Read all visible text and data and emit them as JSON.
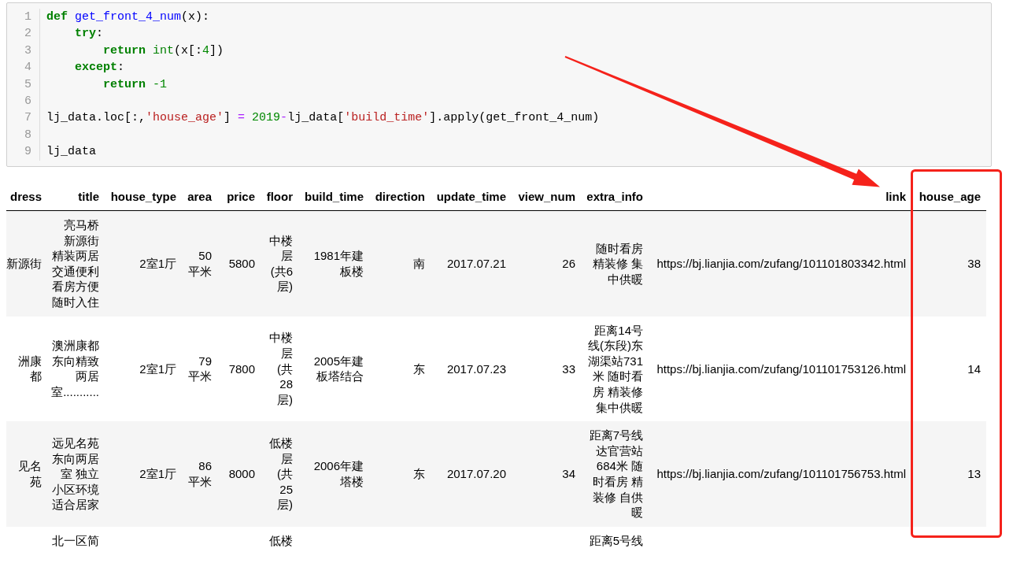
{
  "code_cell": {
    "lines": [
      {
        "number": "1",
        "tokens": [
          {
            "text": "def ",
            "kind": "keyword"
          },
          {
            "text": "get_front_4_num",
            "kind": "def"
          },
          {
            "text": "(x):",
            "kind": "plain"
          }
        ]
      },
      {
        "number": "2",
        "tokens": [
          {
            "text": "    try",
            "kind": "keyword"
          },
          {
            "text": ":",
            "kind": "plain"
          }
        ]
      },
      {
        "number": "3",
        "tokens": [
          {
            "text": "        return ",
            "kind": "keyword"
          },
          {
            "text": "int",
            "kind": "builtin"
          },
          {
            "text": "(x[:",
            "kind": "plain"
          },
          {
            "text": "4",
            "kind": "number"
          },
          {
            "text": "])",
            "kind": "plain"
          }
        ]
      },
      {
        "number": "4",
        "tokens": [
          {
            "text": "    except",
            "kind": "keyword"
          },
          {
            "text": ":",
            "kind": "plain"
          }
        ]
      },
      {
        "number": "5",
        "tokens": [
          {
            "text": "        return ",
            "kind": "keyword"
          },
          {
            "text": "-1",
            "kind": "number"
          }
        ]
      },
      {
        "number": "6"
      },
      {
        "number": "7",
        "tokens": [
          {
            "text": "lj_data.loc[:,",
            "kind": "plain"
          },
          {
            "text": "'house_age'",
            "kind": "string"
          },
          {
            "text": "] ",
            "kind": "plain"
          },
          {
            "text": "=",
            "kind": "operator"
          },
          {
            "text": " 2019",
            "kind": "number"
          },
          {
            "text": "-",
            "kind": "operator"
          },
          {
            "text": "lj_data[",
            "kind": "plain"
          },
          {
            "text": "'build_time'",
            "kind": "string"
          },
          {
            "text": "].apply(get_front_4_num)",
            "kind": "plain"
          }
        ]
      },
      {
        "number": "8"
      },
      {
        "number": "9",
        "tokens": [
          {
            "text": "lj_data",
            "kind": "plain"
          }
        ]
      }
    ]
  },
  "table": {
    "columns": [
      {
        "label": "dress",
        "highlighted": false
      },
      {
        "label": "title",
        "highlighted": false
      },
      {
        "label": "house_type",
        "highlighted": false
      },
      {
        "label": "area",
        "highlighted": false
      },
      {
        "label": "price",
        "highlighted": false
      },
      {
        "label": "floor",
        "highlighted": false
      },
      {
        "label": "build_time",
        "highlighted": false
      },
      {
        "label": "direction",
        "highlighted": false
      },
      {
        "label": "update_time",
        "highlighted": false
      },
      {
        "label": "view_num",
        "highlighted": false
      },
      {
        "label": "extra_info",
        "highlighted": false
      },
      {
        "label": "link",
        "highlighted": false
      },
      {
        "label": "house_age",
        "highlighted": true
      }
    ],
    "rows": [
      {
        "cells": [
          "新源街",
          [
            "亮马桥",
            "新源街",
            "精装两居",
            "交通便利",
            "看房方便",
            "随时入住"
          ],
          "2室1厅",
          "50平米",
          "5800",
          "中楼层(共6层)",
          "1981年建板楼",
          "南",
          "2017.07.21",
          "26",
          "随时看房精装修 集中供暖",
          "https://bj.lianjia.com/zufang/101101803342.html",
          "38"
        ]
      },
      {
        "cells": [
          [
            "洲康",
            "都"
          ],
          [
            "澳洲康都",
            "东向精致",
            "两居",
            "室..........."
          ],
          "2室1厅",
          "79平米",
          "7800",
          "中楼层(共28层)",
          "2005年建板塔结合",
          "东",
          "2017.07.23",
          "33",
          "距离14号线(东段)东湖渠站731米 随时看房 精装修集中供暖",
          "https://bj.lianjia.com/zufang/101101753126.html",
          "14"
        ]
      },
      {
        "cells": [
          [
            "见名",
            "苑"
          ],
          [
            "远见名苑",
            "东向两居",
            "室 独立",
            "小区环境",
            "适合居家"
          ],
          "2室1厅",
          "86平米",
          "8000",
          "低楼层(共25层)",
          "2006年建塔楼",
          "东",
          "2017.07.20",
          "34",
          "距离7号线达官营站684米 随时看房 精装修 自供暖",
          "https://bj.lianjia.com/zufang/101101756753.html",
          "13"
        ]
      },
      {
        "cells": [
          null,
          "北一区简",
          null,
          null,
          null,
          "低楼",
          null,
          null,
          null,
          null,
          "距离5号线",
          null,
          null
        ]
      }
    ]
  }
}
